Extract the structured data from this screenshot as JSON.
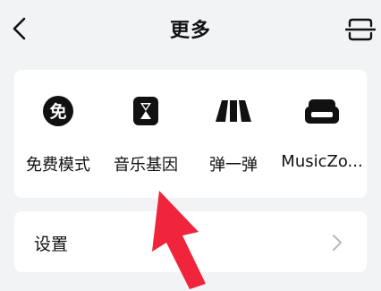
{
  "header": {
    "title": "更多",
    "back_icon": "chevron-left-icon",
    "scan_icon": "scan-icon"
  },
  "entries": [
    {
      "label": "免费模式",
      "icon": "free-mode-icon",
      "icon_text": "免"
    },
    {
      "label": "音乐基因",
      "icon": "hourglass-icon"
    },
    {
      "label": "弹一弹",
      "icon": "piano-keys-icon"
    },
    {
      "label": "MusicZo...",
      "icon": "sofa-icon"
    }
  ],
  "settings": {
    "label": "设置",
    "chevron_icon": "chevron-right-icon"
  },
  "colors": {
    "background": "#f2f3f5",
    "card": "#ffffff",
    "annotation_arrow": "#f0243a"
  }
}
